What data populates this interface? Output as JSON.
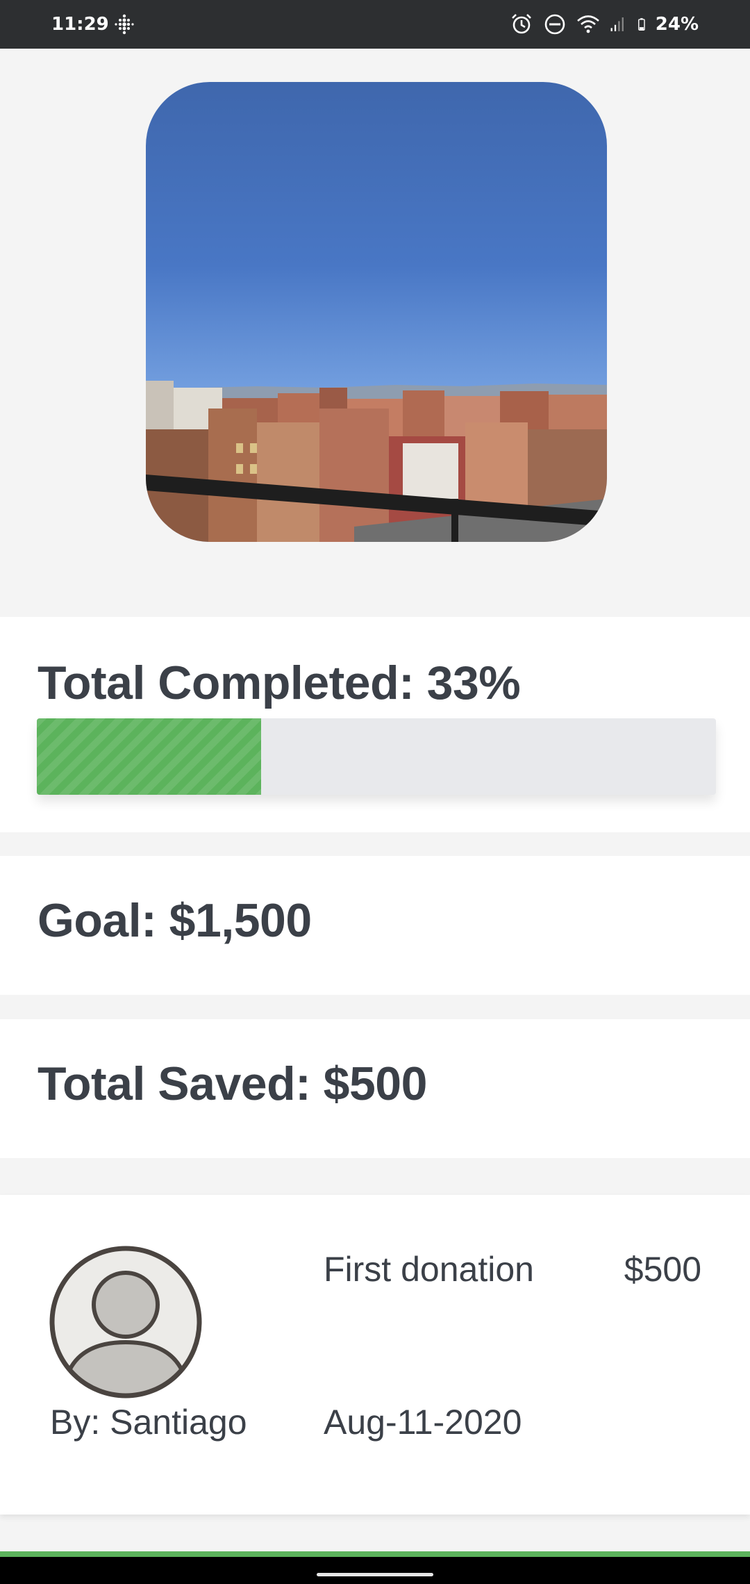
{
  "status_bar": {
    "time": "11:29",
    "battery": "24%",
    "icons": [
      "fitbit-icon",
      "alarm-icon",
      "do-not-disturb-icon",
      "wifi-icon",
      "signal-icon",
      "battery-icon"
    ]
  },
  "progress": {
    "title": "Total Completed: 33%",
    "percent": 33,
    "fill_color": "#5cb35c"
  },
  "goal": {
    "text": "Goal: $1,500"
  },
  "saved": {
    "text": "Total Saved: $500"
  },
  "donation": {
    "avatar_icon": "user-avatar-icon",
    "donor": "By: Santiago",
    "label": "First donation",
    "amount": "$500",
    "date": "Aug-11-2020"
  },
  "colors": {
    "accent": "#5cb35c",
    "text": "#3b4048",
    "status_bar_bg": "#2d2f31"
  }
}
